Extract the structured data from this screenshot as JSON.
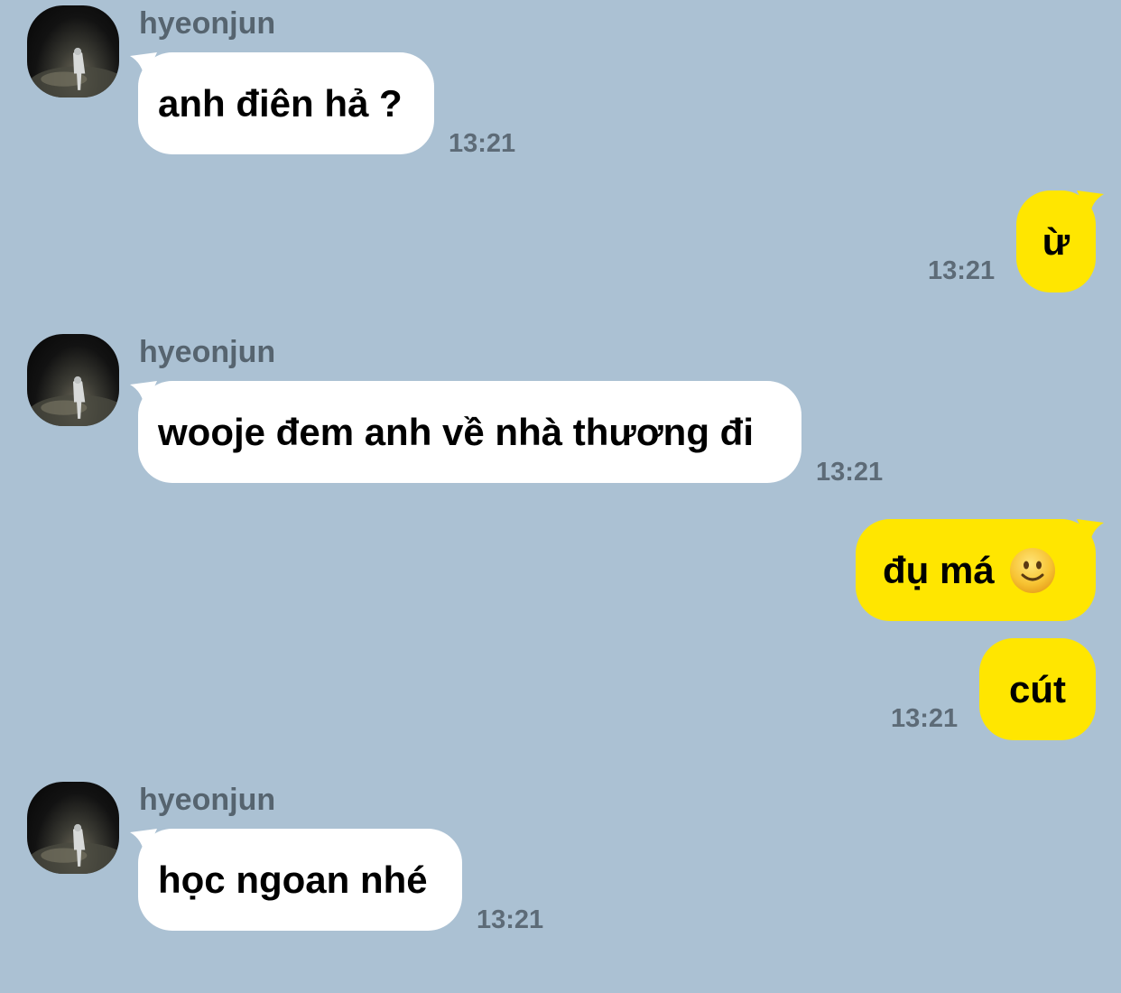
{
  "messages": [
    {
      "sender": "hyeonjun",
      "text": "anh điên hả ?",
      "time": "13:21"
    },
    {
      "text": "ừ",
      "time": "13:21"
    },
    {
      "sender": "hyeonjun",
      "text": "wooje đem anh về nhà thương đi",
      "time": "13:21"
    },
    {
      "text": "đụ má",
      "emoji": "slightly-smiling-face-icon"
    },
    {
      "text": "cút",
      "time": "13:21"
    },
    {
      "sender": "hyeonjun",
      "text": "học ngoan nhé",
      "time": "13:21"
    }
  ],
  "colors": {
    "background": "#abc1d3",
    "incoming_bubble": "#ffffff",
    "outgoing_bubble": "#ffe600",
    "timestamp": "#5d6b77",
    "sender_name": "#56646f"
  }
}
